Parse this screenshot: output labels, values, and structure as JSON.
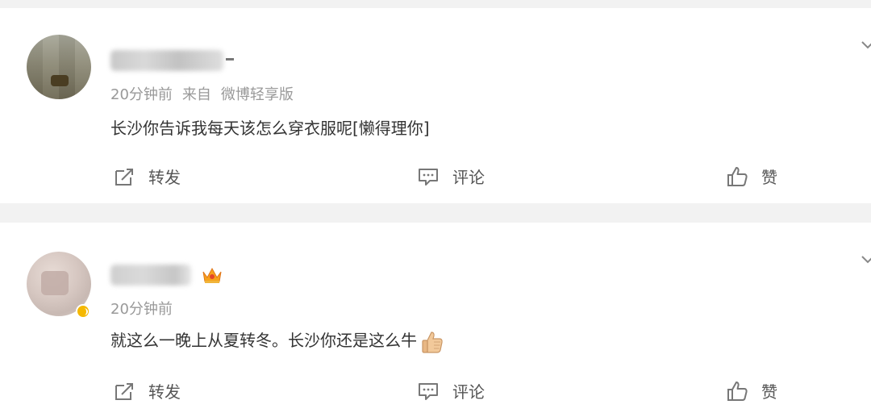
{
  "posts": [
    {
      "time": "20分钟前",
      "source_prefix": "来自",
      "source": "微博轻享版",
      "content": "长沙你告诉我每天该怎么穿衣服呢[懒得理你]",
      "actions": {
        "repost": "转发",
        "comment": "评论",
        "like": "赞"
      }
    },
    {
      "time": "20分钟前",
      "content": "就这么一晚上从夏转冬。长沙你还是这么牛",
      "actions": {
        "repost": "转发",
        "comment": "评论",
        "like": "赞"
      }
    }
  ],
  "colors": {
    "meta_text": "#999999",
    "body_text": "#333333",
    "page_background": "#f2f2f2",
    "card_background": "#ffffff",
    "vip_badge": "#f5b800"
  },
  "icons": [
    "repost-icon",
    "comment-icon",
    "like-icon",
    "chevron-down-icon",
    "crown-icon",
    "thumbs-up-emoji"
  ]
}
